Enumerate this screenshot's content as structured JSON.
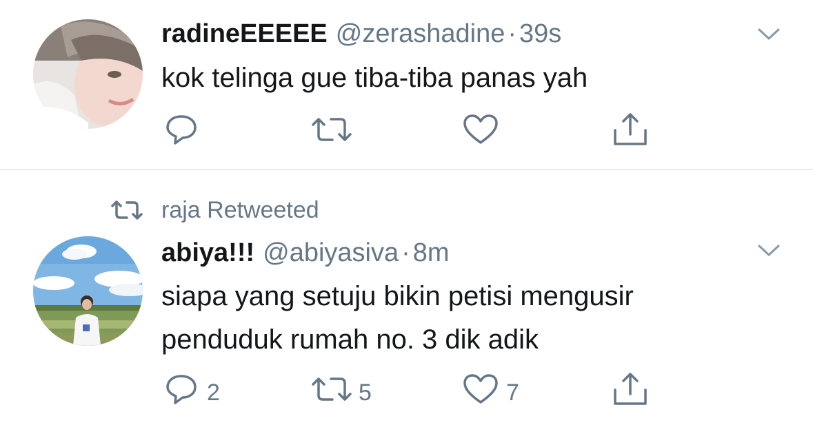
{
  "tweets": [
    {
      "display_name": "radineEEEEE",
      "handle": "@zerashadine",
      "separator": "·",
      "time": "39s",
      "text_lines": [
        "kok telinga gue tiba-tiba panas yah"
      ],
      "reply_count": "",
      "retweet_count": "",
      "like_count": ""
    },
    {
      "retweet_context": "raja Retweeted",
      "display_name": "abiya!!!",
      "handle": "@abiyasiva",
      "separator": "·",
      "time": "8m",
      "text_lines": [
        "siapa yang setuju bikin petisi mengusir",
        "penduduk rumah no. 3 dik adik"
      ],
      "reply_count": "2",
      "retweet_count": "5",
      "like_count": "7"
    }
  ],
  "icons": {
    "reply": "reply-bubble-icon",
    "retweet": "retweet-arrows-icon",
    "like": "heart-outline-icon",
    "share": "share-upload-icon",
    "more": "chevron-down-icon"
  },
  "colors": {
    "text_primary": "#14171a",
    "text_secondary": "#657786",
    "icon_gray": "#657786",
    "divider": "#d8dde2"
  }
}
